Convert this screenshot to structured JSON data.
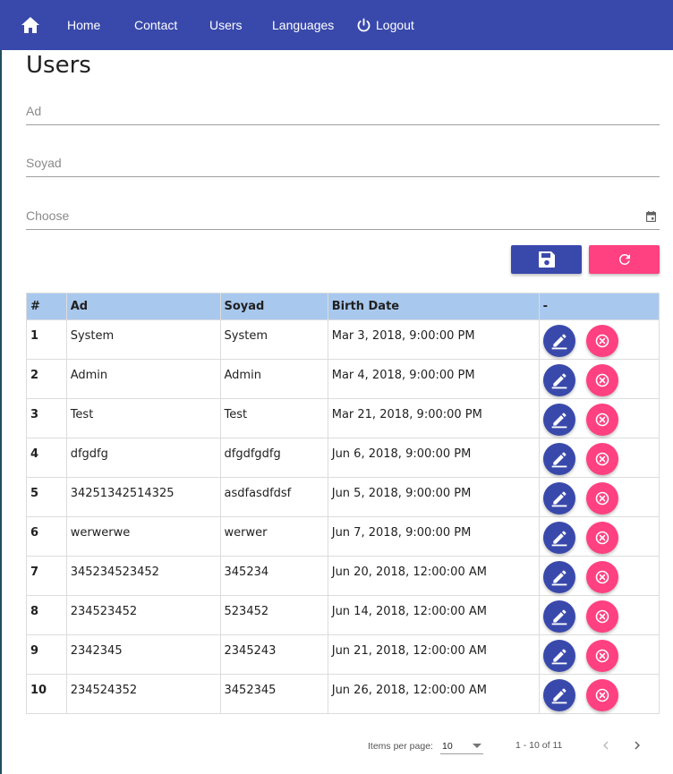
{
  "nav": {
    "home_icon": "home-icon",
    "items": [
      {
        "label": "Home"
      },
      {
        "label": "Contact"
      },
      {
        "label": "Users"
      },
      {
        "label": "Languages"
      },
      {
        "label": "Logout",
        "icon": "power-icon"
      }
    ]
  },
  "page": {
    "title": "Users"
  },
  "form": {
    "ad_placeholder": "Ad",
    "soyad_placeholder": "Soyad",
    "date_placeholder": "Choose",
    "date_icon": "calendar-icon",
    "save_icon": "floppy-disk-icon",
    "reset_icon": "refresh-icon"
  },
  "table": {
    "headers": [
      "#",
      "Ad",
      "Soyad",
      "Birth Date",
      "-"
    ],
    "rows": [
      {
        "no": "1",
        "ad": "System",
        "soyad": "System",
        "date": "Mar 3, 2018, 9:00:00 PM"
      },
      {
        "no": "2",
        "ad": "Admin",
        "soyad": "Admin",
        "date": "Mar 4, 2018, 9:00:00 PM"
      },
      {
        "no": "3",
        "ad": "Test",
        "soyad": "Test",
        "date": "Mar 21, 2018, 9:00:00 PM"
      },
      {
        "no": "4",
        "ad": "dfgdfg",
        "soyad": "dfgdfgdfg",
        "date": "Jun 6, 2018, 9:00:00 PM"
      },
      {
        "no": "5",
        "ad": "34251342514325",
        "soyad": "asdfasdfdsf",
        "date": "Jun 5, 2018, 9:00:00 PM"
      },
      {
        "no": "6",
        "ad": "werwerwe",
        "soyad": "werwer",
        "date": "Jun 7, 2018, 9:00:00 PM"
      },
      {
        "no": "7",
        "ad": "345234523452",
        "soyad": "345234",
        "date": "Jun 20, 2018, 12:00:00 AM"
      },
      {
        "no": "8",
        "ad": "234523452",
        "soyad": "523452",
        "date": "Jun 14, 2018, 12:00:00 AM"
      },
      {
        "no": "9",
        "ad": "2342345",
        "soyad": "2345243",
        "date": "Jun 21, 2018, 12:00:00 AM"
      },
      {
        "no": "10",
        "ad": "234524352",
        "soyad": "3452345",
        "date": "Jun 26, 2018, 12:00:00 AM"
      }
    ],
    "edit_icon": "pencil-icon",
    "delete_icon": "close-circle-icon"
  },
  "paginator": {
    "items_per_page_label": "Items per page:",
    "page_size": "10",
    "range": "1 - 10 of 11"
  },
  "colors": {
    "primary": "#3949ab",
    "accent": "#ff4081",
    "header_bg": "#a9c8ee"
  }
}
